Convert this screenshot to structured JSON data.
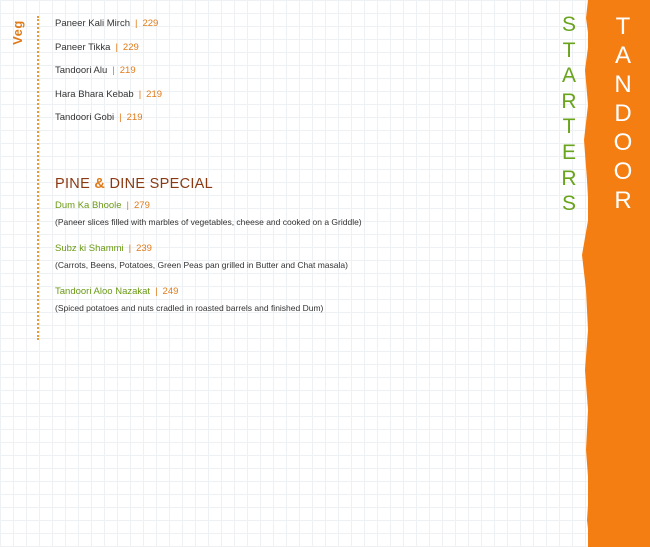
{
  "section_tag": "Veg",
  "items": [
    {
      "name": "Paneer Kali Mirch",
      "price": "229"
    },
    {
      "name": "Paneer Tikka",
      "price": "229"
    },
    {
      "name": "Tandoori Alu",
      "price": "219"
    },
    {
      "name": "Hara Bhara Kebab",
      "price": "219"
    },
    {
      "name": "Tandoori Gobi",
      "price": "219"
    }
  ],
  "separator": "|",
  "special": {
    "title_part1": "PINE ",
    "title_amp": "&",
    "title_part2": " DINE SPECIAL",
    "items": [
      {
        "name": "Dum Ka Bhoole",
        "price": "279",
        "desc": "(Paneer slices filled with marbles of vegetables, cheese and cooked on a Griddle)"
      },
      {
        "name": "Subz ki Shammi",
        "price": "239",
        "desc": "(Carrots, Beens, Potatoes, Green Peas pan grilled in Butter and Chat masala)"
      },
      {
        "name": "Tandoori Aloo Nazakat",
        "price": "249",
        "desc": "(Spiced potatoes and nuts cradled in roasted barrels and finished Dum)"
      }
    ]
  },
  "side_labels": {
    "starters": [
      "S",
      "T",
      "A",
      "R",
      "T",
      "E",
      "R",
      "S"
    ],
    "tandoor": [
      "T",
      "A",
      "N",
      "D",
      "O",
      "O",
      "R"
    ]
  },
  "colors": {
    "accent_orange": "#f57e12",
    "green": "#6aa31c",
    "title_brown": "#8a3a12"
  }
}
